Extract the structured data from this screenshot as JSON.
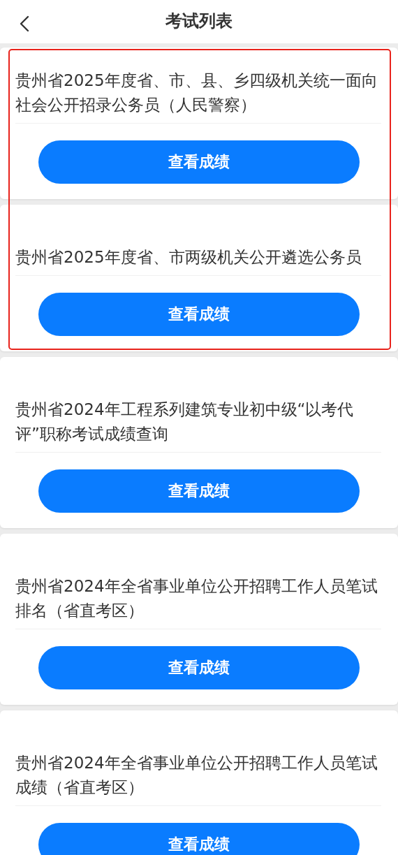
{
  "header": {
    "title": "考试列表"
  },
  "exams": [
    {
      "title": "贵州省2025年度省、市、县、乡四级机关统一面向社会公开招录公务员（人民警察）",
      "button": "查看成绩",
      "highlighted": true
    },
    {
      "title": "贵州省2025年度省、市两级机关公开遴选公务员",
      "button": "查看成绩",
      "highlighted": true
    },
    {
      "title": "贵州省2024年工程系列建筑专业初中级“以考代评”职称考试成绩查询",
      "button": "查看成绩",
      "highlighted": false
    },
    {
      "title": "贵州省2024年全省事业单位公开招聘工作人员笔试排名（省直考区）",
      "button": "查看成绩",
      "highlighted": false
    },
    {
      "title": "贵州省2024年全省事业单位公开招聘工作人员笔试成绩（省直考区）",
      "button": "查看成绩",
      "highlighted": false
    }
  ]
}
